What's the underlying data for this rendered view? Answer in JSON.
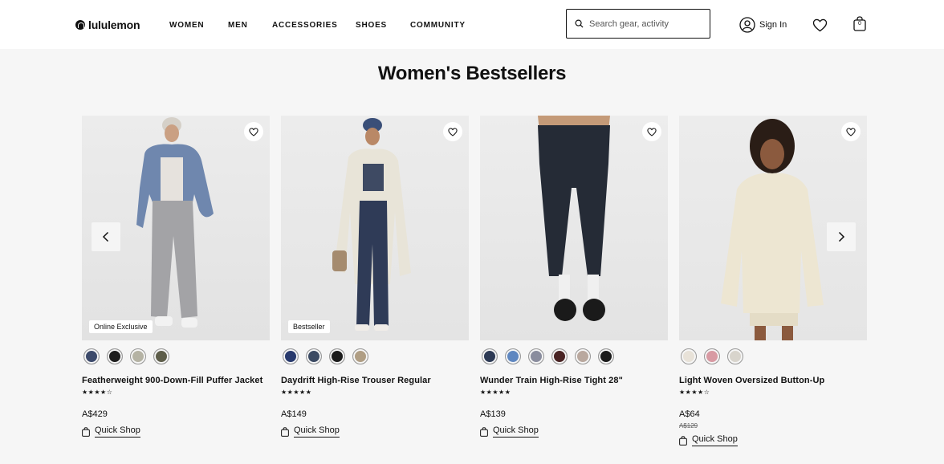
{
  "header": {
    "logo": "lululemon",
    "nav": [
      "WOMEN",
      "MEN",
      "ACCESSORIES",
      "SHOES",
      "COMMUNITY"
    ],
    "search_placeholder": "Search gear, activity",
    "sign_in": "Sign In",
    "bag_count": "0"
  },
  "page_title": "Women's Bestsellers",
  "products": [
    {
      "name": "Featherweight 900-Down-Fill Puffer Jacket",
      "badge": "Online Exclusive",
      "rating": 4,
      "stars": "★★★★☆",
      "price": "A$429",
      "original_price": "",
      "quick_shop": "Quick Shop",
      "swatches": [
        "#3c4a6b",
        "#1e1e1e",
        "#b5b3a4",
        "#5e5e4a"
      ]
    },
    {
      "name": "Daydrift High-Rise Trouser Regular",
      "badge": "Bestseller",
      "rating": 4.5,
      "stars": "★★★★★",
      "price": "A$149",
      "original_price": "",
      "quick_shop": "Quick Shop",
      "swatches": [
        "#283a6e",
        "#3b4a63",
        "#1c1c1c",
        "#b09e84"
      ]
    },
    {
      "name": "Wunder Train High-Rise Tight 28\"",
      "badge": "",
      "rating": 4.5,
      "stars": "★★★★★",
      "price": "A$139",
      "original_price": "",
      "quick_shop": "Quick Shop",
      "swatches": [
        "#2d3a55",
        "#5f87c0",
        "#8a8d9e",
        "#4a2424",
        "#b9a89e",
        "#1a1a1a"
      ]
    },
    {
      "name": "Light Woven Oversized Button-Up",
      "badge": "",
      "rating": 4,
      "stars": "★★★★☆",
      "price": "A$64",
      "original_price": "A$129",
      "quick_shop": "Quick Shop",
      "swatches": [
        "#e8e2d8",
        "#d89aa3",
        "#d8d4cc"
      ]
    }
  ]
}
